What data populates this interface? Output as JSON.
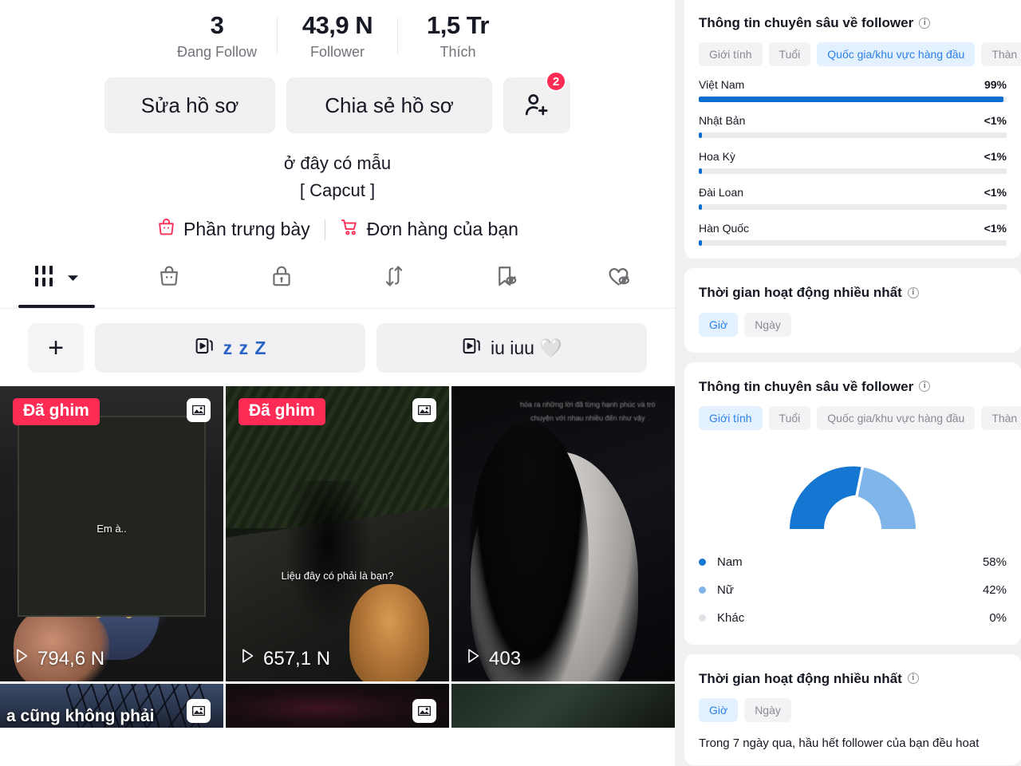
{
  "profile": {
    "stats": [
      {
        "value": "3",
        "label": "Đang Follow",
        "name": "following"
      },
      {
        "value": "43,9 N",
        "label": "Follower",
        "name": "followers"
      },
      {
        "value": "1,5 Tr",
        "label": "Thích",
        "name": "likes"
      }
    ],
    "actions": {
      "edit_label": "Sửa hồ sơ",
      "share_label": "Chia sẻ hồ sơ",
      "add_friends_icon": "person-add-icon",
      "add_friends_badge": "2"
    },
    "bio_line1": "ở đây có mẫu",
    "bio_line2": "[ Capcut ]",
    "shop_links": [
      {
        "icon": "shop-bag-icon",
        "label": "Phần trưng bày"
      },
      {
        "icon": "shopping-cart-icon",
        "label": "Đơn hàng của bạn"
      }
    ],
    "tabs": [
      {
        "name": "tab-videos",
        "icon": "grid-icon",
        "active": true
      },
      {
        "name": "tab-shop",
        "icon": "shop-bag-icon",
        "active": false
      },
      {
        "name": "tab-private",
        "icon": "lock-icon",
        "active": false
      },
      {
        "name": "tab-reposts",
        "icon": "repost-icon",
        "active": false
      },
      {
        "name": "tab-saved",
        "icon": "bookmark-hidden-icon",
        "active": false
      },
      {
        "name": "tab-liked",
        "icon": "heart-hidden-icon",
        "active": false
      }
    ],
    "playlists": {
      "add_label": "+",
      "items": [
        {
          "icon": "playlist-icon",
          "label": "z z Z"
        },
        {
          "icon": "playlist-icon",
          "label": "iu iuu 🤍"
        }
      ]
    },
    "videos": [
      {
        "name": "video-1",
        "pinned_label": "Đã ghim",
        "multi_photo": true,
        "caption": "Em à..",
        "play_count": "794,6 N"
      },
      {
        "name": "video-2",
        "pinned_label": "Đã ghim",
        "multi_photo": true,
        "caption": "Liệu đây có phải là bạn?",
        "play_count": "657,1 N"
      },
      {
        "name": "video-3",
        "pinned_label": "",
        "multi_photo": false,
        "caption": "hóa ra những lời đã từng hạnh phúc và trò chuyện với nhau nhiều đến như vậy",
        "play_count": "403"
      }
    ],
    "videos_row2": [
      {
        "name": "video-4",
        "multi_photo": true,
        "caption": "a cũng không phải"
      },
      {
        "name": "video-5",
        "multi_photo": true,
        "caption": ""
      },
      {
        "name": "video-6",
        "multi_photo": false,
        "caption": ""
      }
    ]
  },
  "insights": {
    "country_card": {
      "title": "Thông tin chuyên sâu về follower",
      "info_glyph": "i",
      "chips": [
        {
          "label": "Giới tính",
          "active": false
        },
        {
          "label": "Tuổi",
          "active": false
        },
        {
          "label": "Quốc gia/khu vực hàng đầu",
          "active": true
        },
        {
          "label": "Thàn",
          "active": false
        }
      ]
    },
    "activity_card_1": {
      "title": "Thời gian hoạt động nhiều nhất",
      "chips": [
        {
          "label": "Giờ",
          "active": true
        },
        {
          "label": "Ngày",
          "active": false
        }
      ]
    },
    "gender_card": {
      "title": "Thông tin chuyên sâu về follower",
      "chips": [
        {
          "label": "Giới tính",
          "active": true
        },
        {
          "label": "Tuổi",
          "active": false
        },
        {
          "label": "Quốc gia/khu vực hàng đầu",
          "active": false
        },
        {
          "label": "Thàn",
          "active": false
        }
      ]
    },
    "activity_card_2": {
      "title": "Thời gian hoạt động nhiều nhất",
      "chips": [
        {
          "label": "Giờ",
          "active": true
        },
        {
          "label": "Ngày",
          "active": false
        }
      ],
      "note": "Trong 7 ngày qua, hầu hết follower của bạn đều hoat"
    },
    "colors": {
      "bar_fill": "#0a6ed1",
      "bar_track": "#ebebed",
      "donut_primary": "#1677d2",
      "donut_secondary": "#7fb5e8",
      "donut_other": "#dfe2e6",
      "chip_active_bg": "#e3f0fd",
      "chip_active_text": "#2c81e8",
      "badge": "#fe2c55"
    }
  },
  "chart_data": [
    {
      "type": "bar",
      "title": "Quốc gia/khu vực hàng đầu",
      "orientation": "horizontal",
      "categories": [
        "Việt Nam",
        "Nhật Bản",
        "Hoa Kỳ",
        "Đài Loan",
        "Hàn Quốc"
      ],
      "values": [
        99,
        0.4,
        0.4,
        0.4,
        0.4
      ],
      "value_labels": [
        "99%",
        "<1%",
        "<1%",
        "<1%",
        "<1%"
      ],
      "xlabel": "",
      "ylabel": "",
      "xlim": [
        0,
        100
      ],
      "grid": false,
      "legend": "none"
    },
    {
      "type": "pie",
      "variant": "half-donut",
      "title": "Giới tính",
      "categories": [
        "Nam",
        "Nữ",
        "Khác"
      ],
      "values": [
        58,
        42,
        0
      ],
      "value_labels": [
        "58%",
        "42%",
        "0%"
      ],
      "colors": [
        "#1677d2",
        "#7fb5e8",
        "#dfe2e6"
      ],
      "legend": "bottom"
    }
  ]
}
